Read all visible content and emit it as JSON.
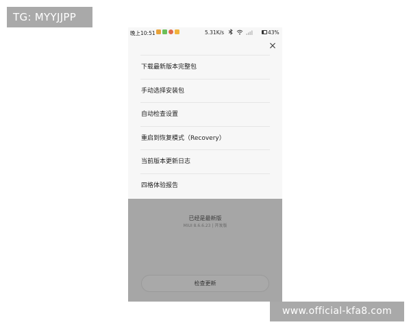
{
  "watermarks": {
    "top_left": "TG: MYYJJPP",
    "bottom_right": "www.official-kfa8.com"
  },
  "statusbar": {
    "time": "晚上10:51",
    "speed": "5.31K/s",
    "battery": "43%",
    "app_icons": [
      {
        "name": "app-icon-1",
        "color": "#e8a23a"
      },
      {
        "name": "app-icon-2",
        "color": "#6bbf59"
      },
      {
        "name": "app-icon-3",
        "color": "#e06b4a"
      },
      {
        "name": "app-icon-4",
        "color": "#f0b33c"
      }
    ],
    "icons": [
      "bluetooth-icon",
      "wifi-icon",
      "signal-icon"
    ]
  },
  "header": {
    "close_icon": "×"
  },
  "menu": {
    "items": [
      {
        "label": "下载最新版本完整包"
      },
      {
        "label": "手动选择安装包"
      },
      {
        "label": "自动检查设置"
      },
      {
        "label": "重启到恢复模式（Recovery）"
      },
      {
        "label": "当前版本更新日志"
      },
      {
        "label": "四格体验报告"
      }
    ]
  },
  "update": {
    "status": "已经是最新版",
    "version": "MIUI 8.6.6.23 | 开发版",
    "check_button": "检查更新"
  }
}
